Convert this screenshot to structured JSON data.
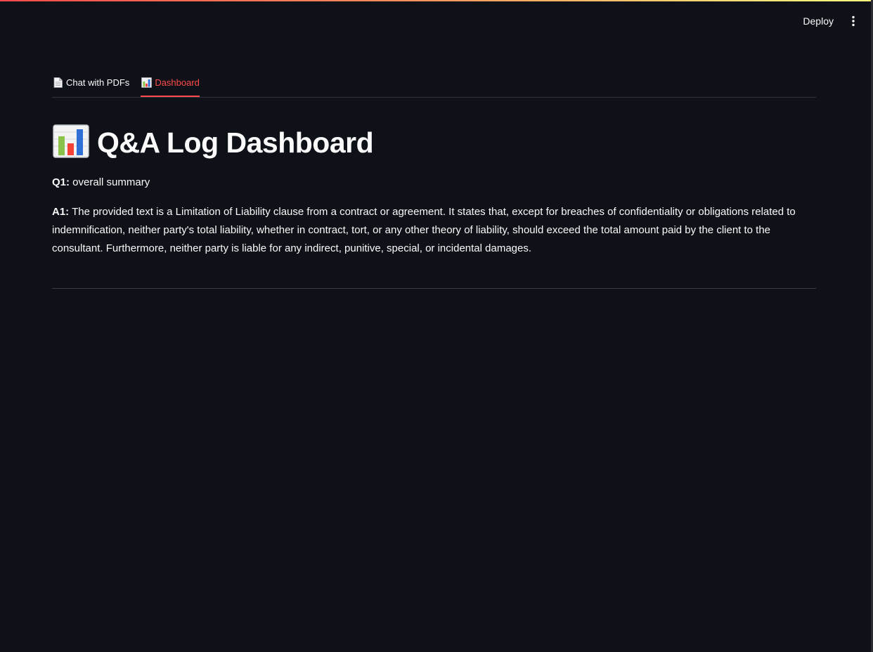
{
  "header": {
    "deploy_label": "Deploy",
    "menu_icon": "more-vertical-icon"
  },
  "tabs": [
    {
      "icon": "document-icon",
      "label": "Chat with PDFs",
      "active": false
    },
    {
      "icon": "bar-chart-icon",
      "label": "Dashboard",
      "active": true
    }
  ],
  "page": {
    "title_icon": "bar-chart-icon",
    "title": "Q&A Log Dashboard"
  },
  "qa_log": [
    {
      "question_label": "Q1:",
      "question": " overall summary",
      "answer_label": "A1:",
      "answer": " The provided text is a Limitation of Liability clause from a contract or agreement. It states that, except for breaches of confidentiality or obligations related to indemnification, neither party's total liability, whether in contract, tort, or any other theory of liability, should exceed the total amount paid by the client to the consultant. Furthermore, neither party is liable for any indirect, punitive, special, or incidental damages."
    }
  ],
  "colors": {
    "background": "#0e1117",
    "accent": "#ff4b4b",
    "text": "#fafafa"
  }
}
